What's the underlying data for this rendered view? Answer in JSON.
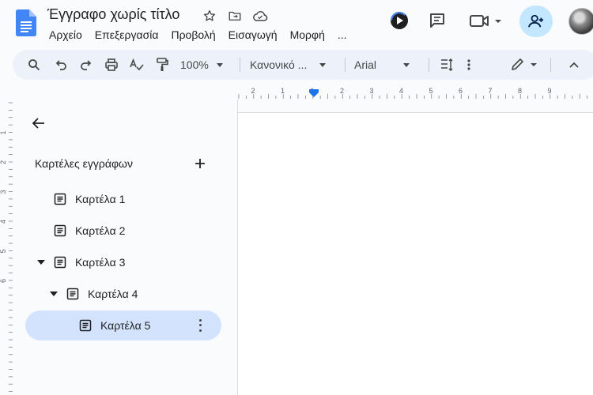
{
  "document": {
    "title": "Έγγραφο χωρίς τίτλο"
  },
  "menu": [
    {
      "label": "Αρχείο"
    },
    {
      "label": "Επεξεργασία"
    },
    {
      "label": "Προβολή"
    },
    {
      "label": "Εισαγωγή"
    },
    {
      "label": "Μορφή"
    },
    {
      "label": "..."
    }
  ],
  "title_icons": [
    "star-icon",
    "move-to-folder-icon",
    "cloud-saved-icon"
  ],
  "top_right_icons": [
    "gemini-icon",
    "comment-icon",
    "video-call-icon",
    "share-add-person-icon",
    "avatar"
  ],
  "toolbar": {
    "zoom": "100%",
    "style": "Κανονικό ...",
    "font": "Arial",
    "icons": [
      "search-icon",
      "undo-icon",
      "redo-icon",
      "print-icon",
      "spellcheck-icon",
      "paint-format-icon",
      "line-spacing-icon",
      "more-vert-icon",
      "edit-mode-icon",
      "collapse-icon"
    ]
  },
  "ruler": {
    "labels": [
      "2",
      "1",
      "1",
      "2",
      "3",
      "4",
      "5",
      "6",
      "7",
      "8",
      "9"
    ],
    "vertical_labels": [
      "1",
      "2",
      "3",
      "4",
      "5",
      "6"
    ]
  },
  "sidebar": {
    "title": "Καρτέλες εγγράφων",
    "tabs": [
      {
        "label": "Καρτέλα 1",
        "expanded": null,
        "active": false
      },
      {
        "label": "Καρτέλα 2",
        "expanded": null,
        "active": false
      },
      {
        "label": "Καρτέλα 3",
        "expanded": true,
        "active": false
      },
      {
        "label": "Καρτέλα 4",
        "expanded": true,
        "active": false
      },
      {
        "label": "Καρτέλα 5",
        "expanded": null,
        "active": true
      }
    ]
  },
  "colors": {
    "background": "#f9fbfd",
    "toolbar": "#edf2fa",
    "active_tab": "#d3e3fd",
    "share_button": "#c2e7ff",
    "docs_blue": "#4285f4",
    "ruler_marker": "#1a73e8"
  }
}
